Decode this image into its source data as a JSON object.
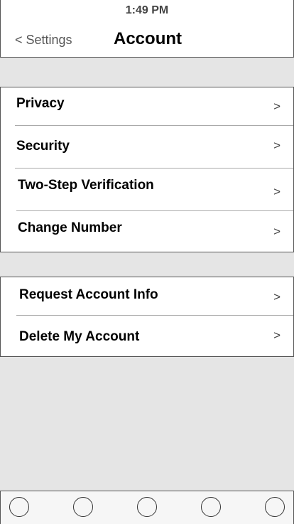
{
  "status_bar": {
    "time": "1:49 PM"
  },
  "nav": {
    "back_label": "< Settings",
    "title": "Account"
  },
  "groups": [
    {
      "items": [
        {
          "label": "Privacy",
          "chevron": ">"
        },
        {
          "label": "Security",
          "chevron": ">"
        },
        {
          "label": "Two-Step Verification",
          "chevron": ">"
        },
        {
          "label": "Change Number",
          "chevron": ">"
        }
      ]
    },
    {
      "items": [
        {
          "label": "Request Account Info",
          "chevron": ">"
        },
        {
          "label": "Delete My Account",
          "chevron": ">"
        }
      ]
    }
  ],
  "tab_bar": {
    "tabs": [
      {
        "icon": "circle-icon"
      },
      {
        "icon": "circle-icon"
      },
      {
        "icon": "circle-icon"
      },
      {
        "icon": "circle-icon"
      },
      {
        "icon": "circle-icon"
      }
    ]
  }
}
